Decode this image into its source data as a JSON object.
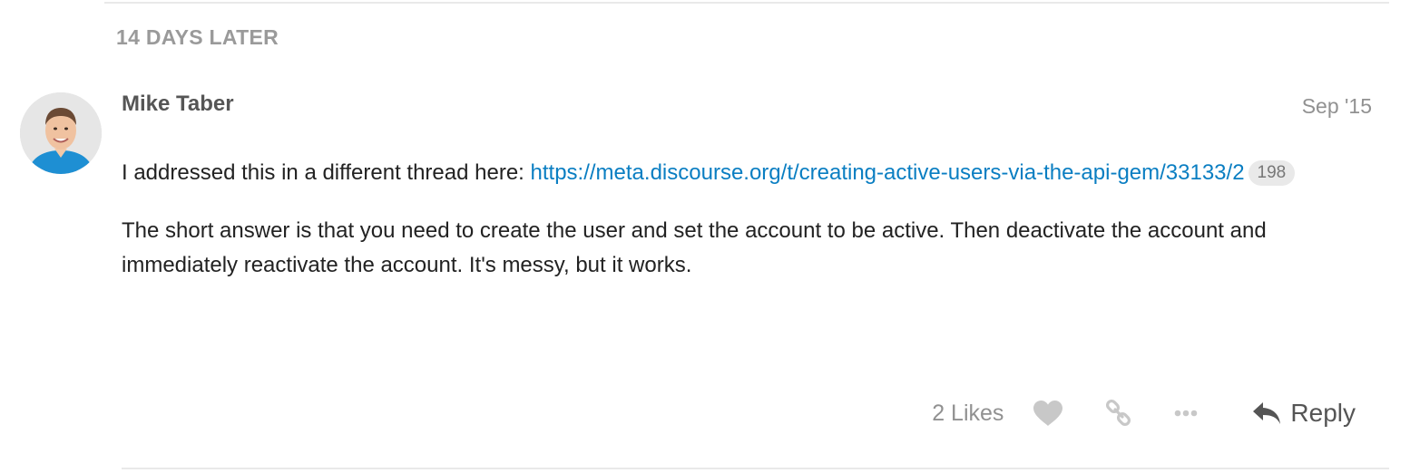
{
  "time_gap": {
    "label": "14 DAYS LATER"
  },
  "post": {
    "author": {
      "name": "Mike Taber",
      "avatar_icon": "user-avatar-photo"
    },
    "date": "Sep '15",
    "paragraph1": {
      "text": "I addressed this in a different thread here: ",
      "link_text": "https://meta.discourse.org/t/creating-active-users-via-the-api-gem/33133/2",
      "link_clicks": "198"
    },
    "paragraph2": {
      "text": "The short answer is that you need to create the user and set the account to be active. Then deactivate the account and immediately reactivate the account. It's messy, but it works."
    }
  },
  "actions": {
    "likes_label": "2 Likes",
    "like_icon": "heart-icon",
    "link_icon": "link-icon",
    "more_icon": "ellipsis-icon",
    "reply_icon": "reply-arrow-icon",
    "reply_label": "Reply"
  },
  "colors": {
    "link": "#0a7ec2",
    "muted": "#919191",
    "icon": "#c8c8c8",
    "divider": "#e9e9e9"
  }
}
